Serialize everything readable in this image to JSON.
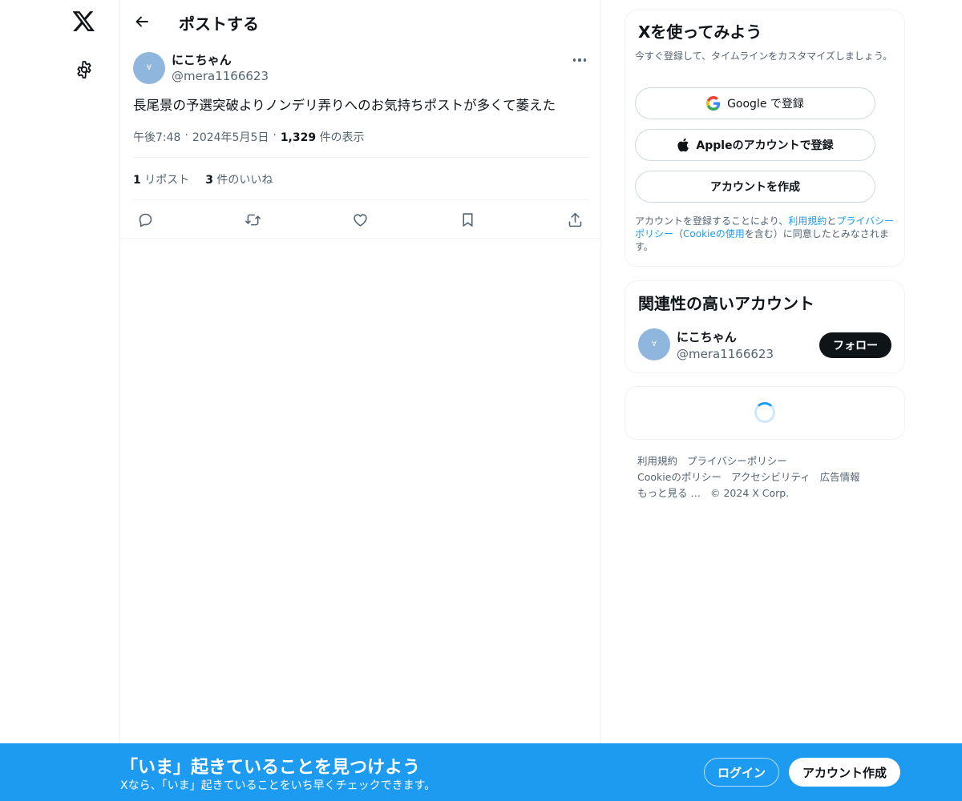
{
  "rail": {
    "logo_icon": "x-logo-icon",
    "settings_icon": "gear-icon"
  },
  "header": {
    "back_icon": "arrow-left-icon",
    "title": "ポストする"
  },
  "post": {
    "avatar_text": "∀",
    "author_name": "にこちゃん",
    "author_handle": "@mera1166623",
    "text": "長尾景の予選突破よりノンデリ弄りへのお気持ちポストが多くて萎えた",
    "time": "午後7:48",
    "dot1": "·",
    "date": "2024年5月5日",
    "dot2": "·",
    "views_count": "1,329",
    "views_label": "件の表示",
    "reposts_count": "1",
    "reposts_label": "リポスト",
    "likes_count": "3",
    "likes_label": "件のいいね",
    "actions": [
      "reply-icon",
      "repost-icon",
      "like-icon",
      "bookmark-icon",
      "share-icon"
    ]
  },
  "signup_card": {
    "title": "Xを使ってみよう",
    "description": "今すぐ登録して、タイムラインをカスタマイズしましょう。",
    "google_label": "Google で登録",
    "apple_label": "Appleのアカウントで登録",
    "create_label": "アカウントを作成",
    "legal_1": "アカウントを登録することにより、",
    "legal_terms": "利用規約",
    "legal_2": "と",
    "legal_privacy": "プライバシーポリシー",
    "legal_3": "（",
    "legal_cookie": "Cookieの使用",
    "legal_4": "を含む）に同意したとみなされます。"
  },
  "relevant_card": {
    "title": "関連性の高いアカウント",
    "avatar_text": "∀",
    "name": "にこちゃん",
    "handle": "@mera1166623",
    "follow_label": "フォロー"
  },
  "footer": {
    "links": [
      "利用規約",
      "プライバシーポリシー",
      "Cookieのポリシー",
      "アクセシビリティ",
      "広告情報",
      "もっと見る …"
    ],
    "copyright": "© 2024 X Corp."
  },
  "bottom_bar": {
    "title": "「いま」起きていることを見つけよう",
    "subtitle": "Xなら、「いま」起きていることをいち早くチェックできます。",
    "login_label": "ログイン",
    "signup_label": "アカウント作成"
  },
  "colors": {
    "accent": "#1d9bf0",
    "text": "#0f1419",
    "muted": "#536471",
    "border": "#eff3f4"
  }
}
